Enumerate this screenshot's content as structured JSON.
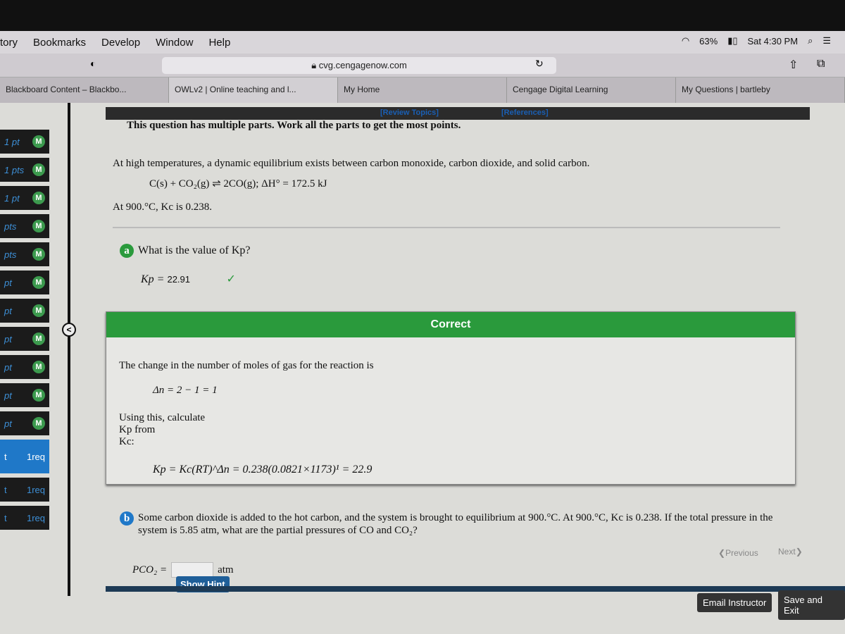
{
  "menubar": {
    "items": [
      "tory",
      "Bookmarks",
      "Develop",
      "Window",
      "Help"
    ],
    "battery": "63%",
    "clock": "Sat 4:30 PM"
  },
  "browser": {
    "url": "cvg.cengagenow.com",
    "tabs": [
      "Blackboard Content – Blackbo...",
      "OWLv2 | Online teaching and l...",
      "My Home",
      "Cengage Digital Learning",
      "My Questions | bartleby"
    ]
  },
  "header": {
    "review_topics": "[Review Topics]",
    "references": "[References]"
  },
  "sidebar": {
    "items": [
      {
        "label": "1 pt",
        "badge": "M"
      },
      {
        "label": "1 pts",
        "badge": "M"
      },
      {
        "label": "1 pt",
        "badge": "M"
      },
      {
        "label": "pts",
        "badge": "M"
      },
      {
        "label": "pts",
        "badge": "M"
      },
      {
        "label": "pt",
        "badge": "M"
      },
      {
        "label": "pt",
        "badge": "M"
      },
      {
        "label": "pt",
        "badge": "M"
      },
      {
        "label": "pt",
        "badge": "M"
      },
      {
        "label": "pt",
        "badge": "M"
      },
      {
        "label": "pt",
        "badge": "M"
      },
      {
        "label": "t",
        "badge": "1req"
      },
      {
        "label": "t",
        "badge": "1req"
      },
      {
        "label": "t",
        "badge": "1req"
      }
    ]
  },
  "question": {
    "multipart_note": "This question has multiple parts. Work all the parts to get the most points.",
    "intro": "At high temperatures, a dynamic equilibrium exists between carbon monoxide, carbon dioxide, and solid carbon.",
    "equation": "C(s) + CO₂(g) ⇌ 2CO(g);  ΔH° = 172.5 kJ",
    "kc_statement": "At 900.°C, Kc is 0.238.",
    "part_a": {
      "letter": "a",
      "prompt": "What is the value of Kp?",
      "answer_label": "Kp =",
      "answer_value": "22.91",
      "status": "✓"
    },
    "feedback": {
      "title": "Correct",
      "line1": "The change in the number of moles of gas for the reaction is",
      "delta_n": "Δn = 2 − 1 = 1",
      "line2": "Using this, calculate",
      "line3": "Kp from",
      "line4": "Kc:",
      "formula": "Kp = Kc(RT)^Δn = 0.238(0.0821×1173)¹ = 22.9"
    },
    "part_b": {
      "letter": "b",
      "prompt": "Some carbon dioxide is added to the hot carbon, and the system is brought to equilibrium at 900.°C. At 900.°C, Kc is 0.238. If the total pressure in the system is 5.85 atm, what are the partial pressures of CO and CO₂?",
      "answer_label": "PCO₂ =",
      "answer_value": "",
      "unit": "atm",
      "hint_button": "Show Hint"
    }
  },
  "nav": {
    "previous": "Previous",
    "next": "Next",
    "email": "Email Instructor",
    "save_exit": "Save and Exit"
  },
  "colors": {
    "correct_green": "#2a9a3c",
    "badge_green": "#3c9a4e",
    "part_badge_a": "#2a9a3c",
    "part_badge_b": "#1f78c8"
  }
}
